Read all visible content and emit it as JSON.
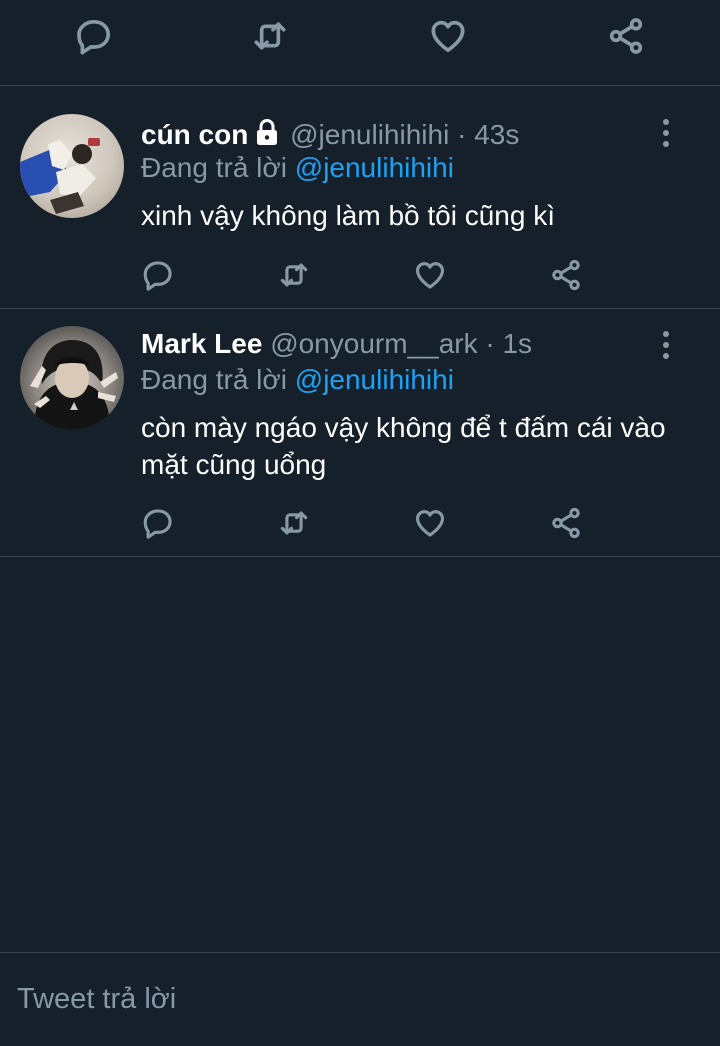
{
  "top_actions": {
    "icons": [
      "reply-icon",
      "retweet-icon",
      "like-icon",
      "share-icon"
    ]
  },
  "tweets": [
    {
      "name": "cún con",
      "locked": true,
      "handle": "@jenulihihihi",
      "time": "· 43s",
      "replying_label": "Đang trả lời",
      "replying_to": "@jenulihihihi",
      "text": "xinh vậy không làm bồ tôi cũng kì"
    },
    {
      "name": "Mark Lee",
      "locked": false,
      "handle": "@onyourm__ark",
      "time": "· 1s",
      "replying_label": "Đang trả lời",
      "replying_to": "@jenulihihihi",
      "text": "còn mày ngáo vậy không để t đấm cái vào mặt cũng uổng"
    }
  ],
  "reply_bar": {
    "placeholder": "Tweet trả lời"
  },
  "colors": {
    "background": "#15202b",
    "divider": "#38444d",
    "secondary_text": "#8899a6",
    "accent": "#1da1f2"
  }
}
